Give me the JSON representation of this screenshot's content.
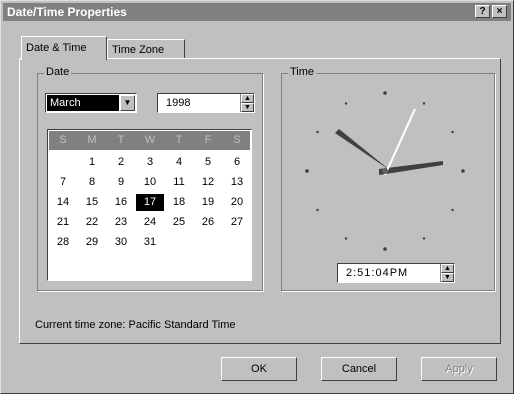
{
  "window": {
    "title": "Date/Time Properties",
    "help_btn": "?",
    "close_btn": "×"
  },
  "tabs": [
    "Date & Time",
    "Time Zone"
  ],
  "date_group": {
    "label": "Date",
    "month": "March",
    "year": "1998",
    "weekdays": [
      "S",
      "M",
      "T",
      "W",
      "T",
      "F",
      "S"
    ],
    "weeks": [
      [
        "",
        "",
        "1",
        "2",
        "3",
        "4",
        "5",
        "6"
      ],
      [
        "7",
        "8",
        "9",
        "10",
        "11",
        "12",
        "13"
      ],
      [
        "14",
        "15",
        "16",
        "17",
        "18",
        "19",
        "20"
      ],
      [
        "21",
        "22",
        "23",
        "24",
        "25",
        "26",
        "27"
      ],
      [
        "28",
        "29",
        "30",
        "31",
        "",
        "",
        ""
      ]
    ],
    "selected_day": "17"
  },
  "time_group": {
    "label": "Time",
    "time": "2:51:04PM"
  },
  "status": "Current time zone:  Pacific Standard Time",
  "buttons": {
    "ok": "OK",
    "cancel": "Cancel",
    "apply": "Apply"
  }
}
